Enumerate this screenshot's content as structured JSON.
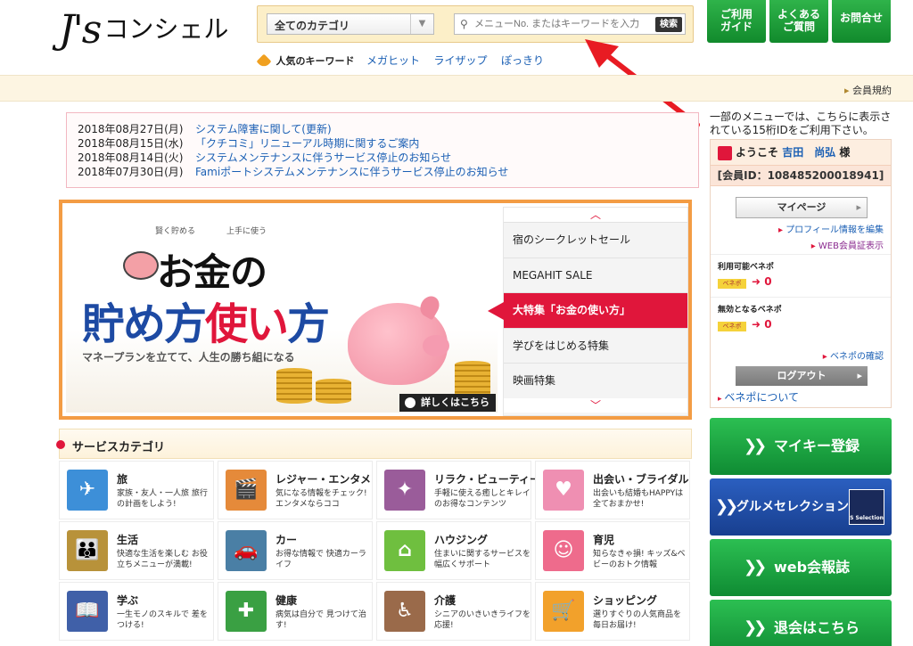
{
  "header": {
    "logo_js": "J's",
    "logo_name": "コンシェル",
    "category_select": "全てのカテゴリ",
    "search_placeholder": "メニューNo. またはキーワードを入力",
    "search_button": "検索",
    "popular_label": "人気のキーワード",
    "popular_keywords": [
      "メガヒット",
      "ライザップ",
      "ぽっきり"
    ],
    "nav": {
      "guide": [
        "ご利用",
        "ガイド"
      ],
      "faq": [
        "よくある",
        "ご質問"
      ],
      "contact": "お問合せ"
    }
  },
  "member_bar": {
    "terms": "会員規約"
  },
  "news": [
    {
      "date": "2018年08月27日(月)",
      "title": "システム障害に関して(更新)"
    },
    {
      "date": "2018年08月15日(水)",
      "title": "「クチコミ」リニューアル時期に関するご案内"
    },
    {
      "date": "2018年08月14日(火)",
      "title": "システムメンテナンスに伴うサービス停止のお知らせ"
    },
    {
      "date": "2018年07月30日(月)",
      "title": "Famiポートシステムメンテナンスに伴うサービス停止のお知らせ"
    }
  ],
  "banner": {
    "tag_left": "賢く貯める",
    "tag_right": "上手に使う",
    "line1": "お金の",
    "line2_a": "貯め方",
    "line2_b": "使い",
    "line2_c": "方",
    "subtitle": "マネープランを立てて、人生の勝ち組になる",
    "detail_button": "詳しくはこちら",
    "features": [
      "宿のシークレットセール",
      "MEGAHIT SALE",
      "大特集「お金の使い方」",
      "学びをはじめる特集",
      "映画特集"
    ],
    "active_feature_index": 2
  },
  "services": {
    "heading": "サービスカテゴリ",
    "items": [
      {
        "name": "旅",
        "desc": "家族・友人・一人旅 旅行の計画をしよう!",
        "color": "#3d8fd8",
        "icon": "airplane-icon",
        "glyph": "✈"
      },
      {
        "name": "レジャー・エンタメ",
        "desc": "気になる情報をチェック! エンタメならココ",
        "color": "#e58a3a",
        "icon": "clapperboard-icon",
        "glyph": "🎬"
      },
      {
        "name": "リラク・ビューティー",
        "desc": "手軽に使える癒しとキレイのお得なコンテンツ",
        "color": "#9a5c9a",
        "icon": "sparkle-icon",
        "glyph": "✦"
      },
      {
        "name": "出会い・ブライダル",
        "desc": "出会いも結婚もHAPPYは全ておまかせ!",
        "color": "#ef8fb2",
        "icon": "hearts-icon",
        "glyph": "♥"
      },
      {
        "name": "生活",
        "desc": "快適な生活を楽しむ お役立ちメニューが満載!",
        "color": "#b8923a",
        "icon": "family-icon",
        "glyph": "👪"
      },
      {
        "name": "カー",
        "desc": "お得な情報で 快適カーライフ",
        "color": "#4a7fa5",
        "icon": "car-icon",
        "glyph": "🚗"
      },
      {
        "name": "ハウジング",
        "desc": "住まいに関するサービスを幅広くサポート",
        "color": "#6fbf3f",
        "icon": "house-icon",
        "glyph": "⌂"
      },
      {
        "name": "育児",
        "desc": "知らなきゃ損! キッズ&ベビーのおトク情報",
        "color": "#ee6b8c",
        "icon": "baby-face-icon",
        "glyph": "☺"
      },
      {
        "name": "学ぶ",
        "desc": "一生モノのスキルで 差をつける!",
        "color": "#4060a8",
        "icon": "book-icon",
        "glyph": "📖"
      },
      {
        "name": "健康",
        "desc": "病気は自分で 見つけて治す!",
        "color": "#3aa043",
        "icon": "medical-cross-icon",
        "glyph": "✚"
      },
      {
        "name": "介護",
        "desc": "シニアのいきいきライフを応援!",
        "color": "#9a6a4a",
        "icon": "wheelchair-icon",
        "glyph": "♿"
      },
      {
        "name": "ショッピング",
        "desc": "選りすぐりの人気商品を 毎日お届け!",
        "color": "#f2a12b",
        "icon": "cart-icon",
        "glyph": "🛒"
      }
    ]
  },
  "sidebar": {
    "note": "一部のメニューでは、こちらに表示されている15桁IDをご利用下さい。",
    "welcome": "ようこそ",
    "user_name": "吉田　尚弘",
    "honorific": "様",
    "member_id": "[会員ID：108485200018941]",
    "mypage": "マイページ",
    "profile_edit": "プロフィール情報を編集",
    "web_card": "WEB会員証表示",
    "benepo_available_label": "利用可能ベネポ",
    "benepo_expiring_label": "無効となるベネポ",
    "benepo_badge": "ベネポ",
    "benepo_available": "0",
    "benepo_expiring": "0",
    "benepo_confirm": "ベネポの確認",
    "logout": "ログアウト",
    "about_benepo": "ベネポについて",
    "buttons": [
      "マイキー登録",
      "グルメセレクション",
      "web会報誌",
      "退会はこちら"
    ],
    "s_selection": "S Selection"
  }
}
